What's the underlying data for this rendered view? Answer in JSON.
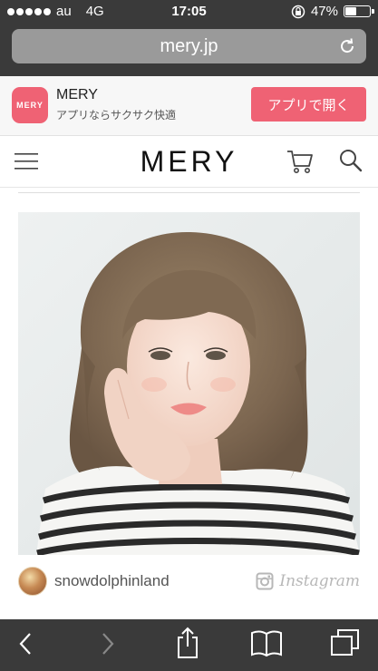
{
  "status_bar": {
    "carrier": "au",
    "network": "4G",
    "time": "17:05",
    "battery": "47%",
    "battery_level": 0.47,
    "signal_bars_filled": 5
  },
  "browser": {
    "url": "mery.jp",
    "reload_icon": "reload-icon"
  },
  "app_banner": {
    "icon_text": "MERY",
    "app_name": "MERY",
    "tagline": "アプリならサクサク快適",
    "open_button": "アプリで開く"
  },
  "header": {
    "logo": "MERY",
    "menu_icon": "hamburger-icon",
    "cart_icon": "cart-icon",
    "search_icon": "search-icon"
  },
  "photo_credit": {
    "username": "snowdolphinland",
    "source": "Instagram"
  },
  "toolbar": {
    "icons": [
      "back-icon",
      "forward-icon",
      "share-icon",
      "bookmarks-icon",
      "tabs-icon"
    ]
  },
  "colors": {
    "brand_pink": "#ef6274",
    "chrome_dark": "#3a3a3a",
    "url_field": "#9a9a9a"
  }
}
